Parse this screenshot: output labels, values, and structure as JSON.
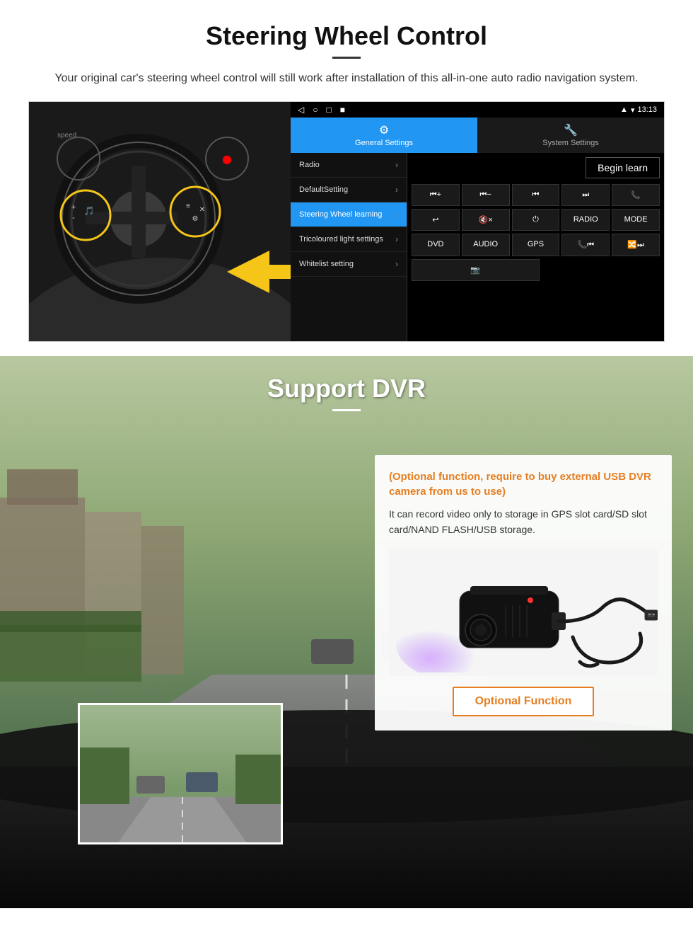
{
  "steering": {
    "title": "Steering Wheel Control",
    "description": "Your original car's steering wheel control will still work after installation of this all-in-one auto radio navigation system.",
    "statusbar": {
      "time": "13:13",
      "nav_icons": [
        "◁",
        "○",
        "□",
        "■"
      ]
    },
    "tabs": [
      {
        "label": "General Settings",
        "icon": "⚙",
        "active": true
      },
      {
        "label": "System Settings",
        "icon": "🔧",
        "active": false
      }
    ],
    "menu_items": [
      {
        "label": "Radio",
        "active": false
      },
      {
        "label": "DefaultSetting",
        "active": false
      },
      {
        "label": "Steering Wheel learning",
        "active": true
      },
      {
        "label": "Tricoloured light settings",
        "active": false
      },
      {
        "label": "Whitelist setting",
        "active": false
      }
    ],
    "begin_learn_label": "Begin learn",
    "control_buttons": [
      [
        "⏮+",
        "⏮-",
        "⏮",
        "⏭",
        "📞"
      ],
      [
        "↩",
        "🔇×",
        "⏻",
        "RADIO",
        "MODE"
      ],
      [
        "DVD",
        "AUDIO",
        "GPS",
        "📞⏮",
        "🔀⏭"
      ],
      [
        "📷"
      ]
    ]
  },
  "dvr": {
    "title": "Support DVR",
    "card": {
      "title": "(Optional function, require to buy external USB DVR camera from us to use)",
      "description": "It can record video only to storage in GPS slot card/SD slot card/NAND FLASH/USB storage.",
      "optional_function_label": "Optional Function"
    }
  }
}
